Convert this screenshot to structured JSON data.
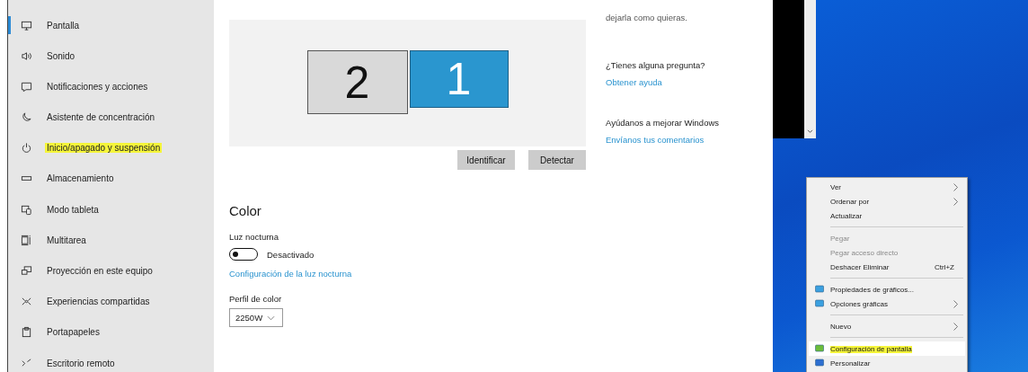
{
  "sidebar": {
    "items": [
      {
        "label": "Pantalla",
        "selected": true,
        "marker": false
      },
      {
        "label": "Sonido",
        "selected": false,
        "marker": false
      },
      {
        "label": "Notificaciones y acciones",
        "selected": false,
        "marker": false
      },
      {
        "label": "Asistente de concentración",
        "selected": false,
        "marker": false
      },
      {
        "label": "Inicio/apagado y suspensión",
        "selected": false,
        "marker": true
      },
      {
        "label": "Almacenamiento",
        "selected": false,
        "marker": false
      },
      {
        "label": "Modo tableta",
        "selected": false,
        "marker": false
      },
      {
        "label": "Multitarea",
        "selected": false,
        "marker": false
      },
      {
        "label": "Proyección en este equipo",
        "selected": false,
        "marker": false
      },
      {
        "label": "Experiencias compartidas",
        "selected": false,
        "marker": false
      },
      {
        "label": "Portapapeles",
        "selected": false,
        "marker": false
      },
      {
        "label": "Escritorio remoto",
        "selected": false,
        "marker": false
      }
    ]
  },
  "display_arrangement": {
    "monitors": [
      {
        "label": "2",
        "selected": false
      },
      {
        "label": "1",
        "selected": true
      }
    ],
    "buttons": [
      "Identificar",
      "Detectar"
    ]
  },
  "color_section": {
    "heading": "Color",
    "night_light_label": "Luz nocturna",
    "night_light_toggle": {
      "on": false,
      "state_text": "Desactivado"
    },
    "night_light_link": "Configuración de la luz nocturna",
    "profile_label": "Perfil de color",
    "profile_dropdown": {
      "value": "2250W"
    }
  },
  "related": {
    "intro_tail": "dejarla como quieras.",
    "question": "¿Tienes alguna pregunta?",
    "help_link": "Obtener ayuda",
    "feedback_heading": "Ayúdanos a mejorar Windows",
    "feedback_link": "Envíanos tus comentarios"
  },
  "context_menu": {
    "items": [
      {
        "kind": "item",
        "label": "Ver",
        "submenu": true,
        "disabled": false,
        "hovered": false,
        "marker": false
      },
      {
        "kind": "item",
        "label": "Ordenar por",
        "submenu": true,
        "disabled": false,
        "hovered": false,
        "marker": false
      },
      {
        "kind": "item",
        "label": "Actualizar",
        "submenu": false,
        "disabled": false,
        "hovered": false,
        "marker": false
      },
      {
        "kind": "separator"
      },
      {
        "kind": "item",
        "label": "Pegar",
        "submenu": false,
        "disabled": true,
        "hovered": false,
        "marker": false
      },
      {
        "kind": "item",
        "label": "Pegar acceso directo",
        "submenu": false,
        "disabled": true,
        "hovered": false,
        "marker": false
      },
      {
        "kind": "item",
        "label": "Deshacer Eliminar",
        "shortcut": "Ctrl+Z",
        "submenu": false,
        "disabled": false,
        "hovered": false,
        "marker": false
      },
      {
        "kind": "separator"
      },
      {
        "kind": "item",
        "label": "Propiedades de gráficos...",
        "submenu": false,
        "disabled": false,
        "hovered": false,
        "marker": false
      },
      {
        "kind": "item",
        "label": "Opciones gráficas",
        "submenu": true,
        "disabled": false,
        "hovered": false,
        "marker": false
      },
      {
        "kind": "separator"
      },
      {
        "kind": "item",
        "label": "Nuevo",
        "submenu": true,
        "disabled": false,
        "hovered": false,
        "marker": false
      },
      {
        "kind": "separator"
      },
      {
        "kind": "item",
        "label": "Configuración de pantalla",
        "submenu": false,
        "disabled": false,
        "hovered": true,
        "marker": true
      },
      {
        "kind": "item",
        "label": "Personalizar",
        "submenu": false,
        "disabled": false,
        "hovered": false,
        "marker": false
      }
    ]
  }
}
